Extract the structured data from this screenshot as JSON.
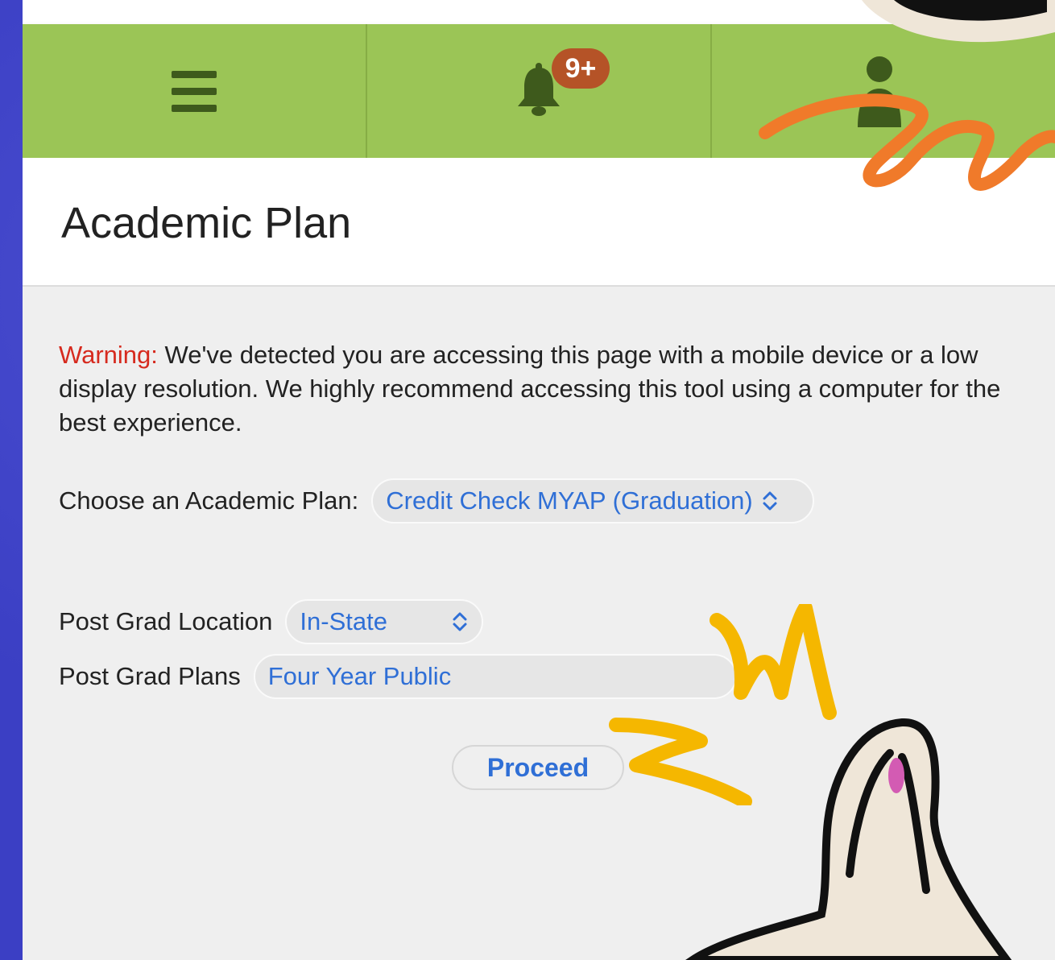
{
  "navbar": {
    "notification_count": "9+"
  },
  "header": {
    "title": "Academic Plan"
  },
  "warning": {
    "label": "Warning:",
    "message": " We've detected you are accessing this page with a mobile device or a low display resolution. We highly recommend accessing this tool using a computer for the best experience."
  },
  "form": {
    "plan_label": "Choose an Academic Plan:",
    "plan_value": "Credit Check MYAP (Graduation)",
    "location_label": "Post Grad Location",
    "location_value": "In-State",
    "plans_label": "Post Grad Plans",
    "plans_value": "Four Year Public",
    "proceed_label": "Proceed"
  },
  "colors": {
    "navbar": "#9bc556",
    "accent_blue": "#2f6fd6",
    "warning_red": "#d62a1e",
    "badge": "#b55327",
    "background": "#3b3fc4"
  },
  "icons": {
    "menu": "hamburger-icon",
    "notifications": "bell-icon",
    "profile": "user-icon",
    "select": "chevron-updown-icon"
  }
}
